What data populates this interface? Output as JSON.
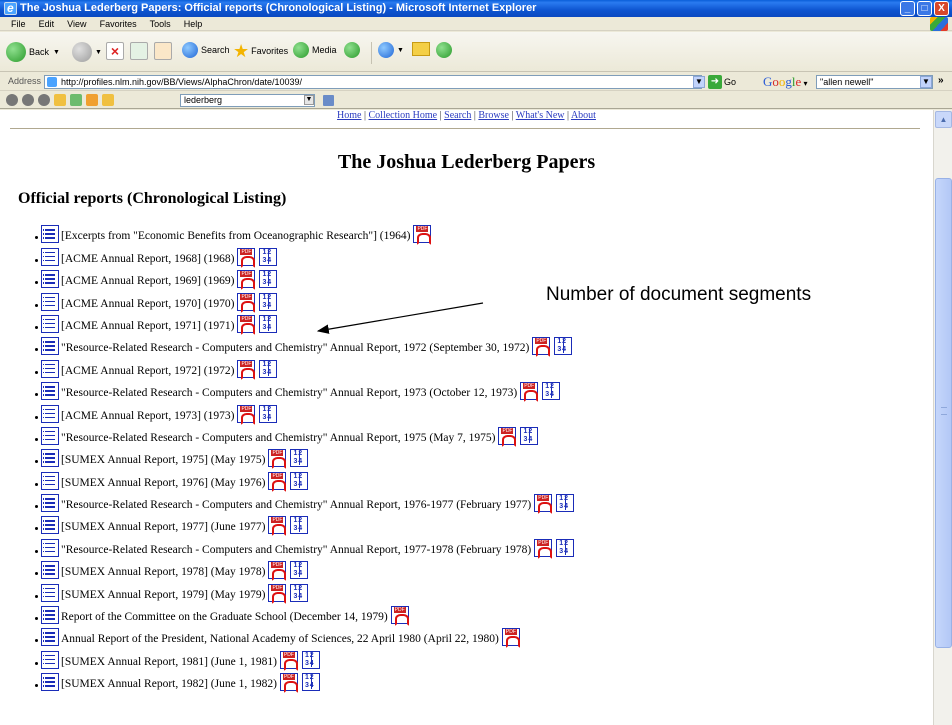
{
  "window": {
    "title": "The Joshua Lederberg Papers: Official reports (Chronological Listing) - Microsoft Internet Explorer",
    "controls": [
      "_",
      "□",
      "X"
    ]
  },
  "menubar": [
    "File",
    "Edit",
    "View",
    "Favorites",
    "Tools",
    "Help"
  ],
  "toolbar": {
    "back_label": "Back",
    "search_label": "Search",
    "favorites_label": "Favorites",
    "media_label": "Media"
  },
  "address": {
    "label": "Address",
    "url": "http://profiles.nlm.nih.gov/BB/Views/AlphaChron/date/10039/",
    "go_label": "Go",
    "google_search_value": "\"allen newell\""
  },
  "linksbar": {
    "search_value": "lederberg"
  },
  "page": {
    "topnav": [
      "Home",
      "Collection Home",
      "Search",
      "Browse",
      "What's New",
      "About"
    ],
    "title": "The Joshua Lederberg Papers",
    "section_title": "Official reports (Chronological Listing)",
    "annotation": "Number of document segments",
    "items": [
      {
        "text": "[Excerpts from \"Economic Benefits from Oceanographic Research\"] (1964)",
        "pdf": true,
        "segments": false
      },
      {
        "text": "[ACME Annual Report, 1968] (1968)",
        "pdf": true,
        "segments": true
      },
      {
        "text": "[ACME Annual Report, 1969] (1969)",
        "pdf": true,
        "segments": true
      },
      {
        "text": "[ACME Annual Report, 1970] (1970)",
        "pdf": true,
        "segments": true
      },
      {
        "text": "[ACME Annual Report, 1971] (1971)",
        "pdf": true,
        "segments": true
      },
      {
        "text": "\"Resource-Related Research - Computers and Chemistry\" Annual Report, 1972 (September 30, 1972)",
        "pdf": true,
        "segments": true
      },
      {
        "text": "[ACME Annual Report, 1972] (1972)",
        "pdf": true,
        "segments": true
      },
      {
        "text": "\"Resource-Related Research - Computers and Chemistry\" Annual Report, 1973 (October 12, 1973)",
        "pdf": true,
        "segments": true
      },
      {
        "text": "[ACME Annual Report, 1973] (1973)",
        "pdf": true,
        "segments": true
      },
      {
        "text": "\"Resource-Related Research - Computers and Chemistry\" Annual Report, 1975 (May 7, 1975)",
        "pdf": true,
        "segments": true
      },
      {
        "text": "[SUMEX Annual Report, 1975] (May 1975)",
        "pdf": true,
        "segments": true
      },
      {
        "text": "[SUMEX Annual Report, 1976] (May 1976)",
        "pdf": true,
        "segments": true
      },
      {
        "text": "\"Resource-Related Research - Computers and Chemistry\" Annual Report, 1976-1977 (February 1977)",
        "pdf": true,
        "segments": true
      },
      {
        "text": "[SUMEX Annual Report, 1977] (June 1977)",
        "pdf": true,
        "segments": true
      },
      {
        "text": "\"Resource-Related Research - Computers and Chemistry\" Annual Report, 1977-1978 (February 1978)",
        "pdf": true,
        "segments": true
      },
      {
        "text": "[SUMEX Annual Report, 1978] (May 1978)",
        "pdf": true,
        "segments": true
      },
      {
        "text": "[SUMEX Annual Report, 1979] (May 1979)",
        "pdf": true,
        "segments": true
      },
      {
        "text": "Report of the Committee on the Graduate School (December 14, 1979)",
        "pdf": true,
        "segments": false
      },
      {
        "text": "Annual Report of the President, National Academy of Sciences, 22 April 1980 (April 22, 1980)",
        "pdf": true,
        "segments": false
      },
      {
        "text": "[SUMEX Annual Report, 1981] (June 1, 1981)",
        "pdf": true,
        "segments": true
      },
      {
        "text": "[SUMEX Annual Report, 1982] (June 1, 1982)",
        "pdf": true,
        "segments": true
      }
    ]
  }
}
